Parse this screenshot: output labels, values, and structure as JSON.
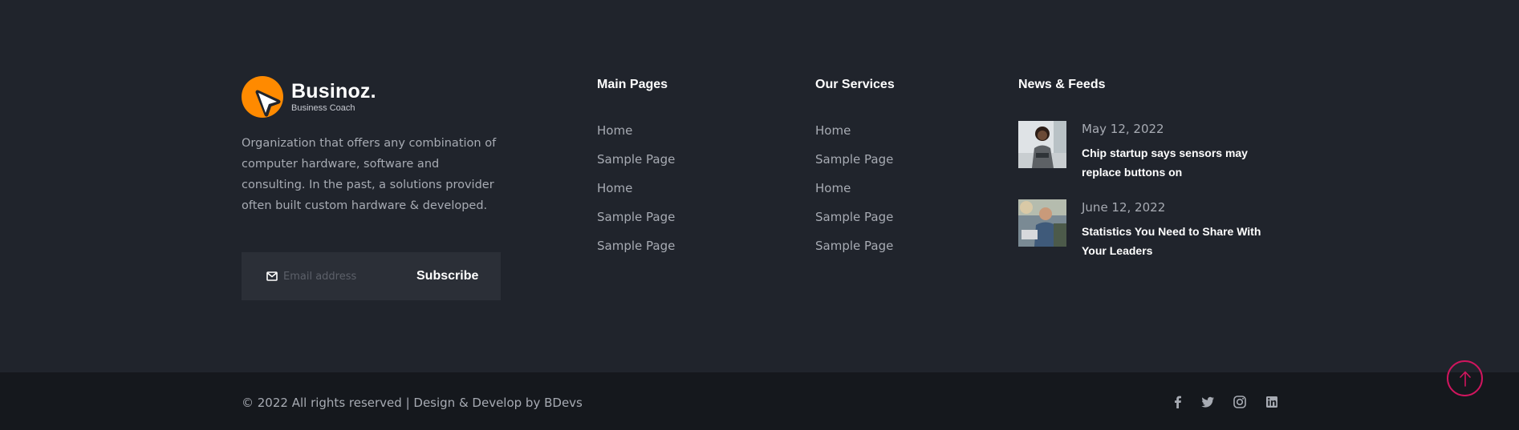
{
  "brand": {
    "name": "Businoz.",
    "tagline": "Business Coach",
    "about": "Organization that offers any combination of computer hardware, software and consulting. In the past, a solutions provider often built custom hardware & developed."
  },
  "subscribe": {
    "placeholder": "Email address",
    "button_label": "Subscribe",
    "icon": "envelope-icon"
  },
  "main_pages": {
    "title": "Main Pages",
    "items": [
      "Home",
      "Sample Page",
      "Home",
      "Sample Page",
      "Sample Page"
    ]
  },
  "our_services": {
    "title": "Our Services",
    "items": [
      "Home",
      "Sample Page",
      "Home",
      "Sample Page",
      "Sample Page"
    ]
  },
  "news": {
    "title": "News & Feeds",
    "items": [
      {
        "date": "May 12, 2022",
        "title": "Chip startup says sensors may replace buttons on"
      },
      {
        "date": "June 12, 2022",
        "title": "Statistics You Need to Share With Your Leaders"
      }
    ]
  },
  "footer_bar": {
    "copyright": "© 2022 All rights reserved | Design & Develop by BDevs",
    "social": [
      "facebook-icon",
      "twitter-icon",
      "instagram-icon",
      "linkedin-icon"
    ]
  },
  "colors": {
    "background": "#20242c",
    "bottom_bar": "#15181d",
    "accent_orange": "#ff8a00",
    "scroll_top_accent": "#d0155e",
    "muted_text": "#a7abb3"
  }
}
